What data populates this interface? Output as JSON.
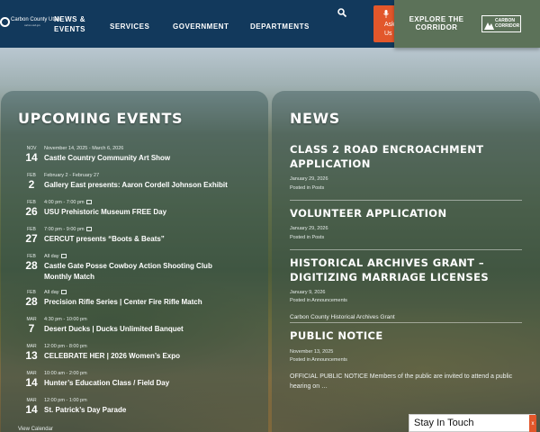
{
  "header": {
    "logo_text": "Carbon County Utah",
    "logo_sub": "carbon.utah.gov",
    "nav": [
      "NEWS & EVENTS",
      "SERVICES",
      "GOVERNMENT",
      "DEPARTMENTS"
    ],
    "search_icon": "search-icon",
    "ask_label": "Ask Us",
    "explore_label": "EXPLORE THE CORRIDOR",
    "corridor_logo": "CARBON CORRIDOR"
  },
  "events": {
    "title": "UPCOMING EVENTS",
    "items": [
      {
        "month": "NOV",
        "day": "14",
        "time": "November 14, 2025 - March 6, 2026",
        "title": "Castle Country Community Art Show"
      },
      {
        "month": "FEB",
        "day": "2",
        "time": "February 2 - February 27",
        "title": "Gallery East presents: Aaron Cordell Johnson Exhibit"
      },
      {
        "month": "FEB",
        "day": "26",
        "time": "4:00 pm - 7:00 pm",
        "title": "USU Prehistoric Museum FREE Day"
      },
      {
        "month": "FEB",
        "day": "27",
        "time": "7:00 pm - 9:00 pm",
        "title": "CERCUT presents “Boots & Beats”"
      },
      {
        "month": "FEB",
        "day": "28",
        "time": "All day",
        "title": "Castle Gate Posse Cowboy Action Shooting Club",
        "title2": "Monthly Match"
      },
      {
        "month": "FEB",
        "day": "28",
        "time": "All day",
        "title": "Precision Rifle Series | Center Fire Rifle Match"
      },
      {
        "month": "MAR",
        "day": "7",
        "time": "4:30 pm - 10:00 pm",
        "title": "Desert Ducks | Ducks Unlimited Banquet"
      },
      {
        "month": "MAR",
        "day": "13",
        "time": "12:00 pm - 8:00 pm",
        "title": "CELEBRATE HER | 2026 Women’s Expo"
      },
      {
        "month": "MAR",
        "day": "14",
        "time": "10:00 am - 2:00 pm",
        "title": "Hunter’s Education Class / Field Day"
      },
      {
        "month": "MAR",
        "day": "14",
        "time": "12:00 pm - 1:00 pm",
        "title": "St. Patrick’s Day Parade"
      }
    ],
    "view_calendar": "View Calendar"
  },
  "news": {
    "title": "NEWS",
    "items": [
      {
        "title": "CLASS 2 ROAD ENCROACHMENT APPLICATION",
        "date": "January 29, 2026",
        "category": "Posted in Posts"
      },
      {
        "title": "VOLUNTEER APPLICATION",
        "date": "January 29, 2026",
        "category": "Posted in Posts"
      },
      {
        "title": "HISTORICAL ARCHIVES GRANT – DIGITIZING MARRIAGE LICENSES",
        "date": "January 9, 2026",
        "category": "Posted in Announcements",
        "extra": "Carbon County Historical Archives Grant"
      },
      {
        "title": "PUBLIC NOTICE",
        "date": "November 13, 2025",
        "category": "Posted in Announcements",
        "excerpt": "OFFICIAL PUBLIC NOTICE Members of the public are invited to attend a public hearing on …"
      }
    ]
  },
  "stay_in_touch": {
    "label": "Stay In Touch",
    "close": "x"
  }
}
